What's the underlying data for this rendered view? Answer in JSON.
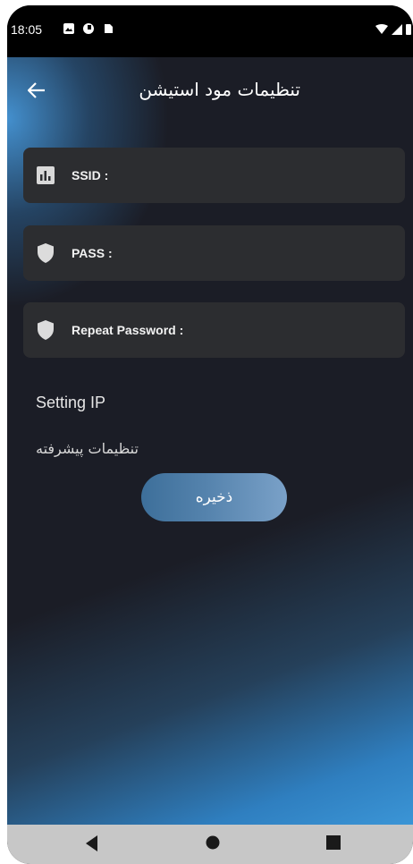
{
  "status_bar": {
    "time": "18:05"
  },
  "app_bar": {
    "title": "تنظیمات مود استیشن",
    "back_icon": "arrow-left-icon"
  },
  "form": {
    "fields": [
      {
        "label": "SSID :",
        "icon": "signal-bars-icon"
      },
      {
        "label": "PASS :",
        "icon": "shield-icon"
      },
      {
        "label": "Repeat Password :",
        "icon": "shield-icon"
      }
    ],
    "section_label": "Setting IP",
    "advanced_link": "تنظیمات پیشرفته",
    "save_label": "ذخیره"
  },
  "nav": {
    "back": "triangle-back-icon",
    "home": "circle-home-icon",
    "recents": "square-recents-icon"
  },
  "colors": {
    "background": "#1b1d26",
    "field_bg": "#2c2d30",
    "accent": "#3b95d6",
    "button": "#5583ad"
  }
}
